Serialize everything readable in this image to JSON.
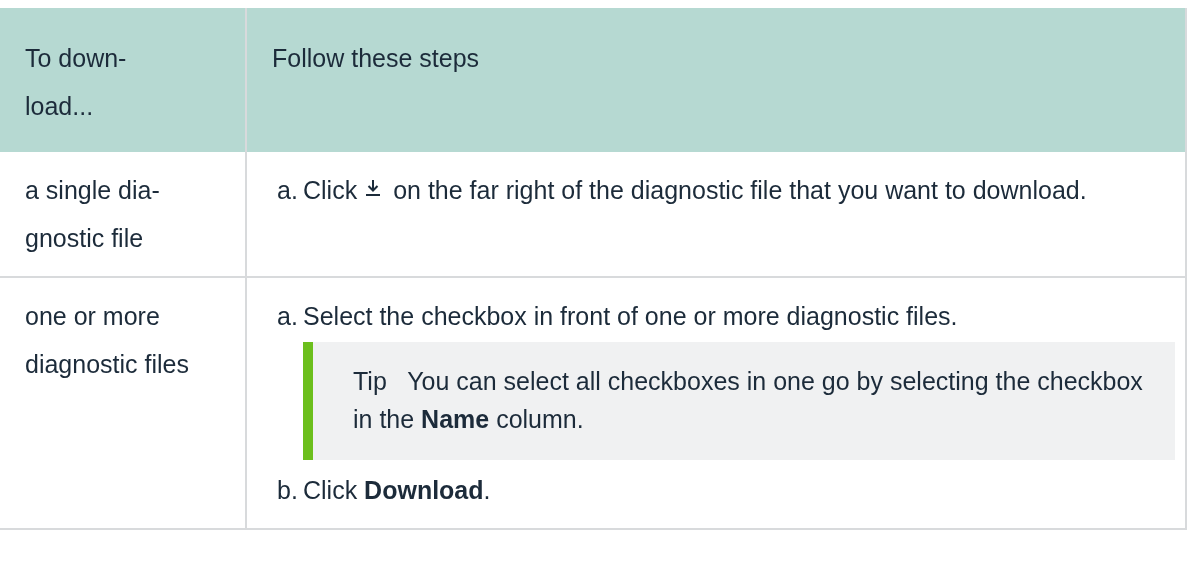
{
  "table": {
    "columns": [
      "To down-load...",
      "Follow these steps"
    ],
    "rows": [
      {
        "situation": "a single dia-gnostic file",
        "steps": [
          {
            "marker": "a.",
            "parts": [
              {
                "kind": "text",
                "text": "Click"
              },
              {
                "kind": "download-icon"
              },
              {
                "kind": "text",
                "text": "on the far right of the diagnostic file that you want to download."
              }
            ]
          }
        ]
      },
      {
        "situation": "one or more diagnostic files",
        "steps": [
          {
            "marker": "a.",
            "parts": [
              {
                "kind": "text",
                "text": "Select the checkbox in front of one or more diagnostic files."
              }
            ],
            "tip": {
              "label": "Tip",
              "text": "You can select all checkboxes in one go by selecting the checkbox in the **Name** column."
            }
          },
          {
            "marker": "b.",
            "parts": [
              {
                "kind": "text",
                "text": "Click **Download**."
              }
            ]
          }
        ]
      }
    ]
  }
}
